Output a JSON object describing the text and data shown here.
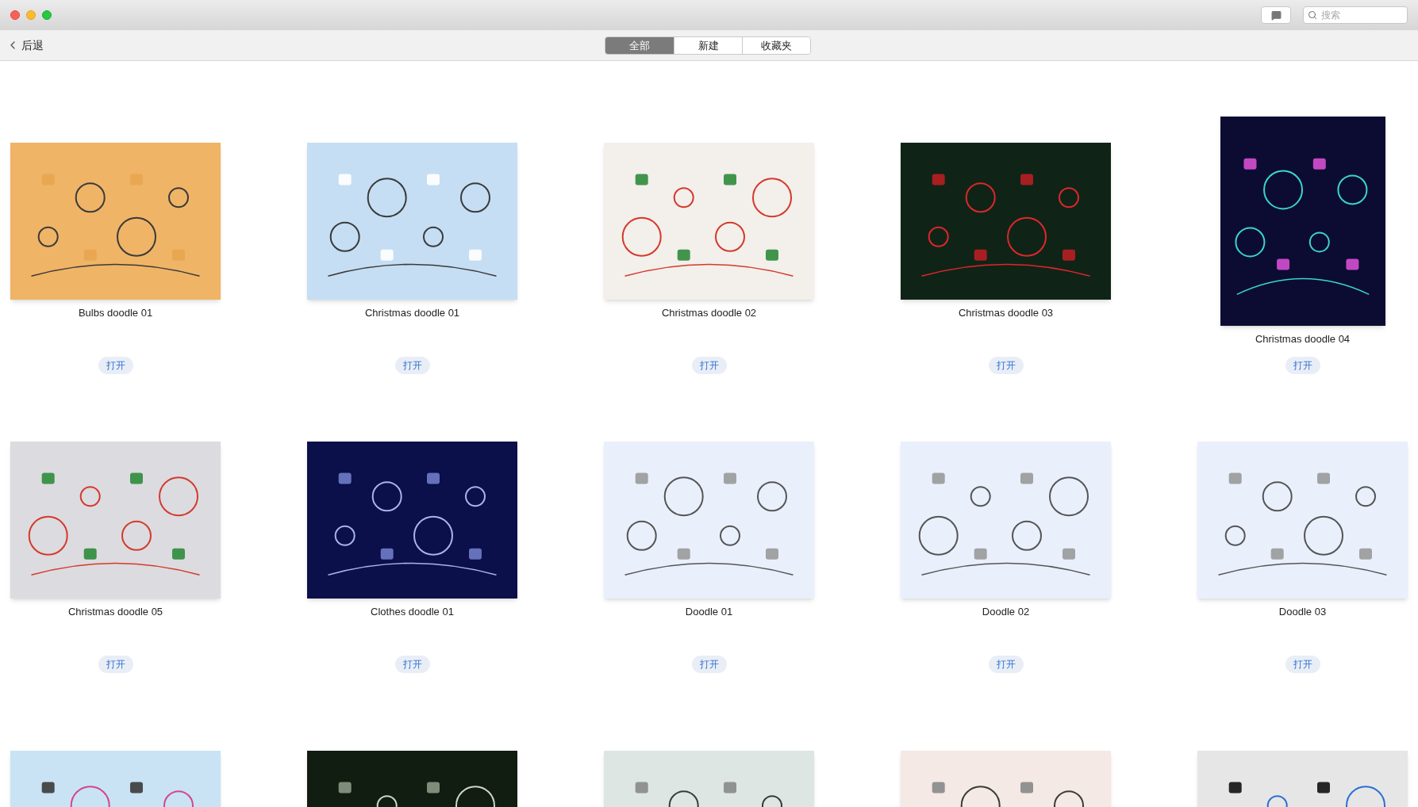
{
  "window": {
    "traffic_lights": [
      {
        "kind": "close"
      },
      {
        "kind": "minimize"
      },
      {
        "kind": "zoom"
      }
    ]
  },
  "search": {
    "placeholder": "搜索"
  },
  "back": {
    "label": "后退"
  },
  "tabs": [
    {
      "label": "全部",
      "selected": true
    },
    {
      "label": "新建",
      "selected": false
    },
    {
      "label": "收藏夹",
      "selected": false
    }
  ],
  "templates": [
    {
      "kind": "landscape",
      "title": "Bulbs doodle 01",
      "button": "打开"
    },
    {
      "kind": "landscape",
      "title": "Christmas doodle 01",
      "button": "打开"
    },
    {
      "kind": "landscape",
      "title": "Christmas doodle 02",
      "button": "打开"
    },
    {
      "kind": "landscape",
      "title": "Christmas doodle 03",
      "button": "打开"
    },
    {
      "kind": "portrait",
      "title": "Christmas doodle 04",
      "button": "打开"
    },
    {
      "kind": "landscape",
      "title": "Christmas doodle 05",
      "button": "打开"
    },
    {
      "kind": "landscape",
      "title": "Clothes doodle 01",
      "button": "打开"
    },
    {
      "kind": "landscape",
      "title": "Doodle 01",
      "button": "打开"
    },
    {
      "kind": "landscape",
      "title": "Doodle 02",
      "button": "打开"
    },
    {
      "kind": "landscape",
      "title": "Doodle 03",
      "button": "打开"
    },
    {
      "kind": "landscape"
    },
    {
      "kind": "landscape"
    },
    {
      "kind": "landscape"
    },
    {
      "kind": "landscape"
    },
    {
      "kind": "landscape"
    }
  ]
}
